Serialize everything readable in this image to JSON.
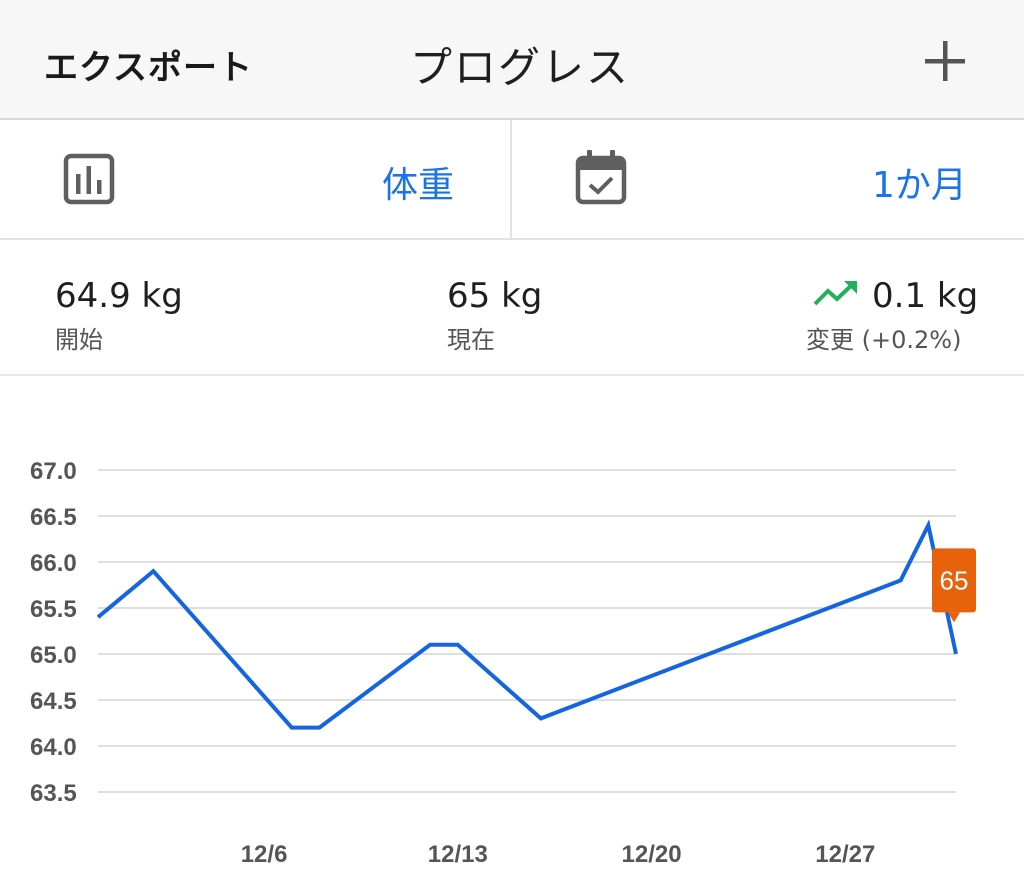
{
  "header": {
    "export_label": "エクスポート",
    "title": "プログレス",
    "add_icon": "plus-icon"
  },
  "selectors": {
    "metric": {
      "icon": "bar-chart-icon",
      "label": "体重"
    },
    "period": {
      "icon": "calendar-check-icon",
      "label": "1か月"
    }
  },
  "stats": {
    "start": {
      "value": "64.9 kg",
      "label": "開始"
    },
    "current": {
      "value": "65 kg",
      "label": "現在"
    },
    "change": {
      "icon": "trending-up-icon",
      "value": "0.1 kg",
      "label": "変更 (+0.2%)"
    }
  },
  "colors": {
    "accent": "#1a73e8",
    "line": "#1565e0",
    "marker": "#e8620c",
    "trend_up": "#22b05a"
  },
  "chart_data": {
    "type": "line",
    "title": "",
    "xlabel": "",
    "ylabel": "",
    "x_ticks": [
      "12/6",
      "12/13",
      "12/20",
      "12/27"
    ],
    "y_ticks": [
      "67.0",
      "66.5",
      "66.0",
      "65.5",
      "65.0",
      "64.5",
      "64.0",
      "63.5"
    ],
    "ylim": [
      63.5,
      67.0
    ],
    "xlim": [
      "11/30",
      "12/31"
    ],
    "grid": true,
    "series": [
      {
        "x": [
          "11/30",
          "12/2",
          "12/7",
          "12/8",
          "12/12",
          "12/13",
          "12/16",
          "12/29",
          "12/30",
          "12/31"
        ],
        "values": [
          65.4,
          65.9,
          64.2,
          64.2,
          65.1,
          65.1,
          64.3,
          65.8,
          66.4,
          65.0
        ]
      }
    ],
    "current_marker": {
      "x": "12/31",
      "label": "65"
    }
  }
}
